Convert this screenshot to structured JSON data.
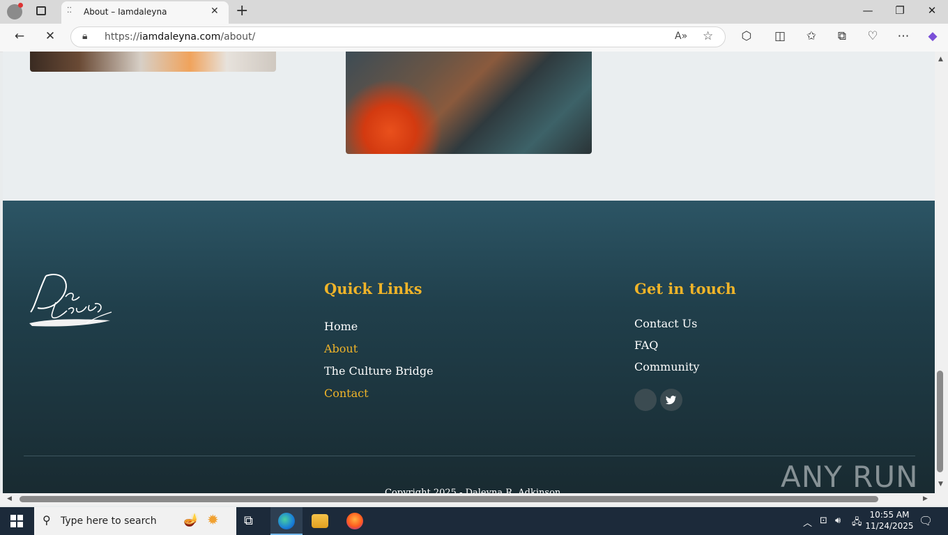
{
  "browser": {
    "tab_title": "About – Iamdaleyna",
    "url_prefix": "https://",
    "url_host": "iamdaleyna.com",
    "url_path": "/about/"
  },
  "footer": {
    "quick_links": {
      "heading": "Quick Links",
      "items": [
        "Home",
        "About",
        "The Culture Bridge",
        "Contact"
      ]
    },
    "get_in_touch": {
      "heading": "Get in touch",
      "items": [
        "Contact Us",
        "FAQ",
        "Community"
      ]
    },
    "copyright": "Copyright 2025 - Daleyna R. Adkinson"
  },
  "watermark": "ANY RUN",
  "taskbar": {
    "search_placeholder": "Type here to search",
    "time": "10:55 AM",
    "date": "11/24/2025"
  },
  "colors": {
    "accent_gold": "#f0b429",
    "footer_top": "#2c5565",
    "footer_bottom": "#18292f"
  },
  "icons": [
    "close-icon",
    "new-tab-icon",
    "back-icon",
    "stop-icon",
    "lock-icon",
    "read-aloud-icon",
    "favorite-icon",
    "extensions-icon",
    "split-screen-icon",
    "favorites-icon",
    "collections-icon",
    "performance-icon",
    "more-icon",
    "copilot-icon",
    "twitter-icon",
    "search-icon",
    "windows-icon",
    "task-view-icon",
    "edge-icon",
    "file-explorer-icon",
    "firefox-icon"
  ]
}
